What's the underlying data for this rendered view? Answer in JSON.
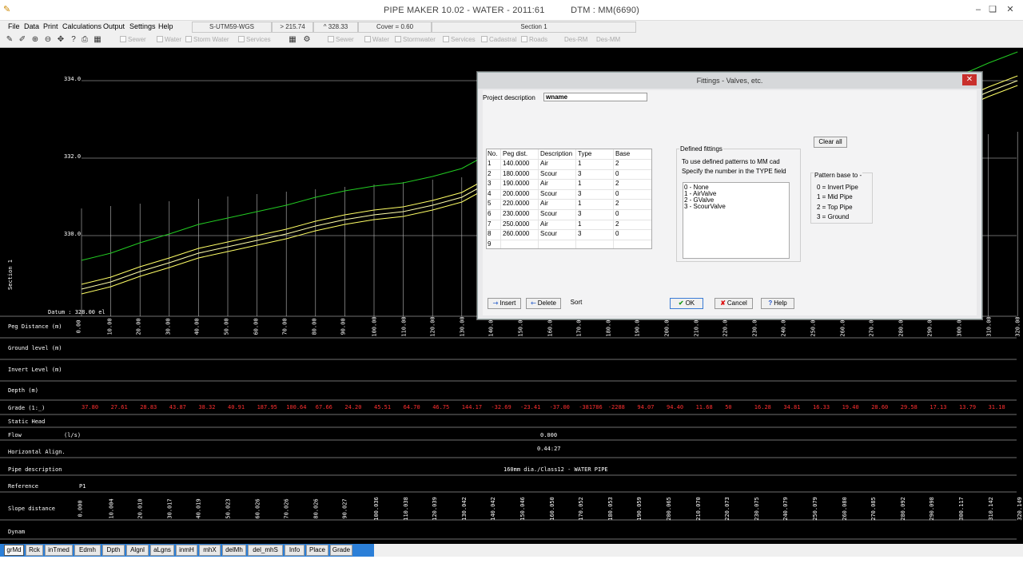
{
  "window": {
    "title": "PIPE MAKER 10.02 - WATER - 2011:61",
    "dtm": "DTM : MM(6690)"
  },
  "menu": [
    "File",
    "Data",
    "Print",
    "Calculations",
    "Output",
    "Settings",
    "Help"
  ],
  "header_fields": {
    "projection": "S-UTM59-WGS",
    "x_coord": "> 215.74",
    "y_coord": "^ 328.33",
    "cover": "Cover = 0.60",
    "section": "Section 1"
  },
  "layers": [
    "Sewer",
    "Water",
    "Storm Water",
    "Services",
    "Sewer",
    "Water",
    "Stormwater",
    "Services",
    "Cadastral",
    "Roads",
    "Des-RM",
    "Des-MM"
  ],
  "profile": {
    "elevations": [
      "334.0",
      "332.0",
      "330.0"
    ],
    "datum": "Datum : 328.00 el",
    "side_label": "Section 1",
    "row_labels": [
      "Peg Distance (m)",
      "Ground level (m)",
      "Invert Level (m)",
      "Depth (m)",
      "Grade (1:_)",
      "Static Head",
      "Flow",
      "(l/s)",
      "Horizontal Align.",
      "Pipe description",
      "Reference",
      "Slope distance",
      "Dynam"
    ],
    "peg_values": [
      "0.00",
      "10.00",
      "20.00",
      "30.00",
      "40.00",
      "50.00",
      "60.00",
      "70.00",
      "80.00",
      "90.00",
      "100.00",
      "110.00",
      "120.00",
      "130.00",
      "140.00",
      "150.00",
      "160.00",
      "170.00",
      "180.00",
      "190.00",
      "200.00",
      "210.00",
      "220.00",
      "230.00",
      "240.00",
      "250.00",
      "260.00",
      "270.00",
      "280.00",
      "290.00",
      "300.00",
      "310.00",
      "320.00"
    ],
    "grade_values": [
      "37.80",
      "27.61",
      "28.83",
      "43.87",
      "38.32",
      "40.91",
      "187.95",
      "100.64",
      "67.66",
      "24.20",
      "45.51",
      "64.70",
      "46.75",
      "144.17",
      "-32.69",
      "-23.41",
      "-37.00",
      "-381786",
      "-2288",
      "94.07",
      "94.40",
      "11.68",
      "50",
      "16.28",
      "34.81",
      "16.33",
      "19.40",
      "28.60",
      "29.58",
      "17.13",
      "13.79",
      "31.18"
    ],
    "flow": "0.000",
    "horizontal_align": "0.44:27",
    "pipe_description": "160mm dia./Class12 - WATER PIPE",
    "reference": "P1",
    "slope_values": [
      "0.000",
      "10.004",
      "20.010",
      "30.017",
      "40.019",
      "50.023",
      "60.026",
      "70.026",
      "80.026",
      "90.027",
      "100.036",
      "110.038",
      "120.039",
      "130.042",
      "140.042",
      "150.046",
      "160.050",
      "170.052",
      "180.053",
      "190.059",
      "200.065",
      "210.070",
      "220.073",
      "230.075",
      "240.079",
      "250.079",
      "260.080",
      "270.085",
      "280.092",
      "290.098",
      "300.117",
      "310.142",
      "320.149"
    ],
    "colors": {
      "ground": "#22cc22",
      "invert": "#ffff66",
      "row_red": "#ff3030"
    }
  },
  "tabs": [
    "grMd",
    "Rck",
    "inTmed",
    "Edmh",
    "Dpth",
    "Algnl",
    "aLgns",
    "inmH",
    "mhX",
    "delMh",
    "del_mhS",
    "Info",
    "Place",
    "Grade"
  ],
  "dialog": {
    "title": "Fittings - Valves, etc.",
    "project_description_label": "Project description",
    "project_description_value": "wname",
    "columns": [
      "No.",
      "Peg dist.",
      "Description",
      "Type",
      "Base"
    ],
    "rows": [
      {
        "no": "1",
        "peg": "140.0000",
        "desc": "Air",
        "type": "1",
        "base": "2"
      },
      {
        "no": "2",
        "peg": "180.0000",
        "desc": "Scour",
        "type": "3",
        "base": "0"
      },
      {
        "no": "3",
        "peg": "190.0000",
        "desc": "Air",
        "type": "1",
        "base": "2"
      },
      {
        "no": "4",
        "peg": "200.0000",
        "desc": "Scour",
        "type": "3",
        "base": "0"
      },
      {
        "no": "5",
        "peg": "220.0000",
        "desc": "Air",
        "type": "1",
        "base": "2"
      },
      {
        "no": "6",
        "peg": "230.0000",
        "desc": "Scour",
        "type": "3",
        "base": "0"
      },
      {
        "no": "7",
        "peg": "250.0000",
        "desc": "Air",
        "type": "1",
        "base": "2"
      },
      {
        "no": "8",
        "peg": "260.0000",
        "desc": "Scour",
        "type": "3",
        "base": "0"
      },
      {
        "no": "9",
        "peg": "",
        "desc": "",
        "type": "",
        "base": ""
      }
    ],
    "defined_fittings_title": "Defined fittings",
    "instructions": [
      "To use defined patterns to MM cad",
      "Specify the number in the TYPE field"
    ],
    "fittings": [
      "0 - None",
      "1 - AirValve",
      "2 - GValve",
      "3 - ScourValve"
    ],
    "clear_all": "Clear all",
    "pattern_base_title": "Pattern base to -",
    "pattern_base": [
      "0 = Invert Pipe",
      "1 = Mid Pipe",
      "2 = Top Pipe",
      "3 = Ground"
    ],
    "buttons": {
      "insert": "Insert",
      "delete": "Delete",
      "sort": "Sort",
      "ok": "OK",
      "cancel": "Cancel",
      "help": "Help"
    }
  }
}
